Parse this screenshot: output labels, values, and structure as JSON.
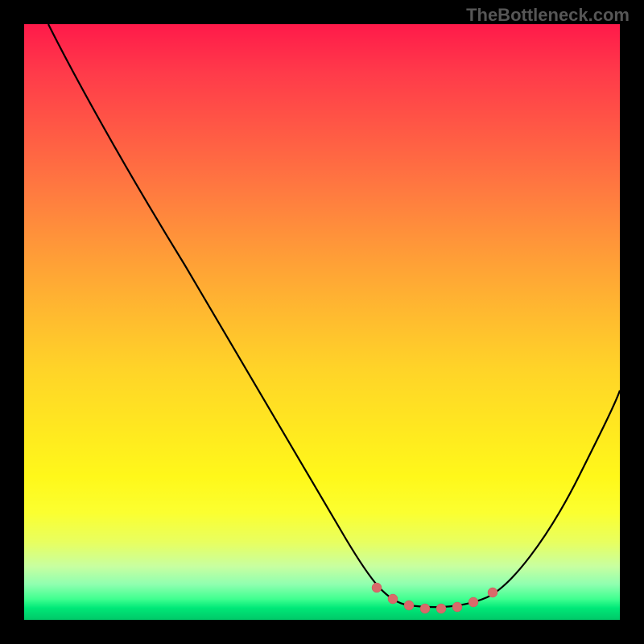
{
  "watermark": "TheBottleneck.com",
  "chart_data": {
    "type": "line",
    "title": "",
    "xlabel": "",
    "ylabel": "",
    "xlim": [
      0,
      100
    ],
    "ylim": [
      0,
      100
    ],
    "series": [
      {
        "name": "bottleneck-curve",
        "x": [
          4,
          10,
          20,
          30,
          40,
          50,
          58,
          62,
          66,
          70,
          74,
          78,
          82,
          88,
          94,
          100
        ],
        "values": [
          100,
          89,
          71,
          53,
          35,
          18,
          6,
          3,
          1,
          0,
          0,
          1,
          3,
          10,
          22,
          38
        ]
      }
    ],
    "markers": {
      "name": "optimal-range",
      "x": [
        59,
        62,
        65,
        68,
        71,
        74,
        77,
        79
      ],
      "values": [
        5,
        3,
        2,
        1,
        1,
        1,
        2,
        4
      ],
      "color": "#d86a6a"
    },
    "gradient_stops": [
      {
        "pos": 0,
        "color": "#ff1a4a"
      },
      {
        "pos": 50,
        "color": "#ffd428"
      },
      {
        "pos": 80,
        "color": "#fff81a"
      },
      {
        "pos": 100,
        "color": "#00c868"
      }
    ]
  }
}
